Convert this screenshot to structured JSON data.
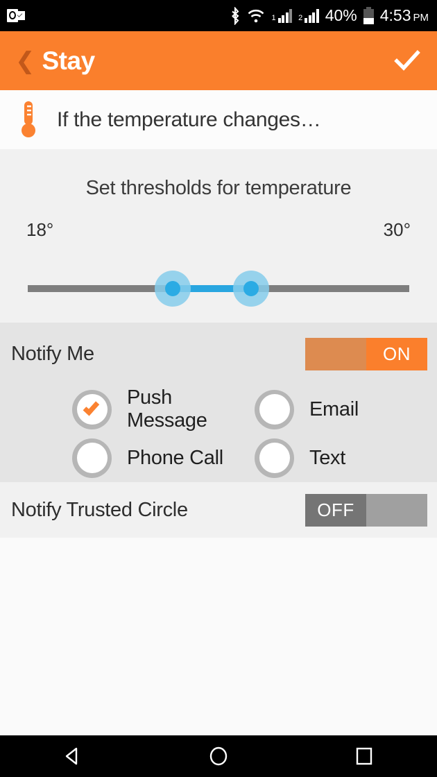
{
  "statusbar": {
    "app_icon": "outlook-icon",
    "bluetooth_icon": "bluetooth-icon",
    "wifi_icon": "wifi-icon",
    "sim1_label": "1",
    "sim2_label": "2",
    "battery_percent": "40%",
    "battery_icon": "battery-icon",
    "time": "4:53",
    "ampm": "PM"
  },
  "appbar": {
    "back_icon": "❮",
    "title": "Stay",
    "done_icon": "check-icon",
    "bg_color": "#fa7f2c"
  },
  "trigger": {
    "icon": "thermometer-icon",
    "text": "If the temperature changes…"
  },
  "threshold": {
    "title": "Set thresholds for temperature",
    "min_value": "18°",
    "max_value": "30°",
    "track_color": "#7e7e7e",
    "active_color": "#29a6e0",
    "handle_color": "#2babe4"
  },
  "notify": {
    "label": "Notify Me",
    "toggle_state": "ON",
    "toggle_on_color": "#fb7f2c",
    "options": [
      {
        "label": "Push Message",
        "checked": true
      },
      {
        "label": "Email",
        "checked": false
      },
      {
        "label": "Phone Call",
        "checked": false
      },
      {
        "label": "Text",
        "checked": false
      }
    ]
  },
  "trusted": {
    "label": "Notify Trusted Circle",
    "toggle_state": "OFF",
    "toggle_off_color": "#a0a0a0"
  },
  "navbar": {
    "back": "nav-back-icon",
    "home": "nav-home-icon",
    "recents": "nav-recents-icon"
  }
}
